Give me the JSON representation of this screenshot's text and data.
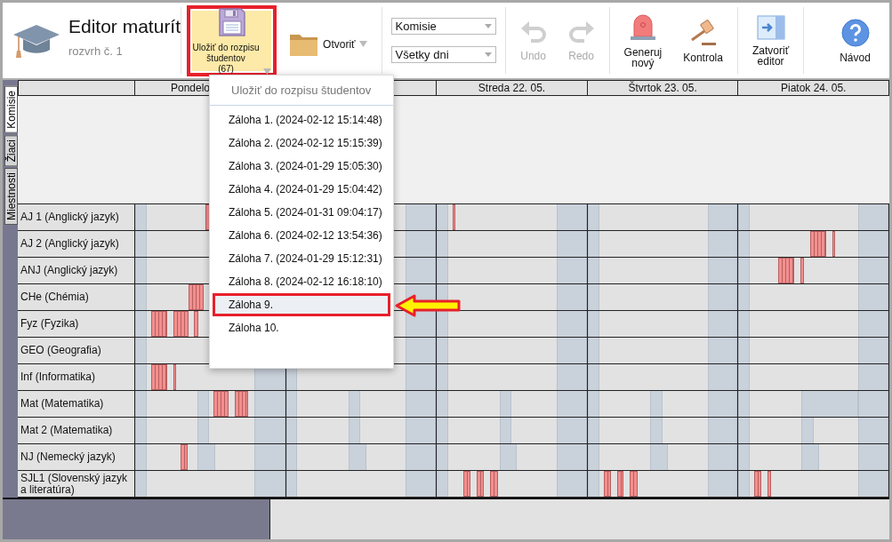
{
  "app": {
    "title": "Editor maturít",
    "subtitle": "rozvrh č. 1"
  },
  "toolbar_groups": [
    {
      "kind": "buttons",
      "items": [
        {
          "kind": "save",
          "label": "Uložiť do rozpisu\nštudentov\n(67)",
          "menu": true,
          "highlighted": true,
          "disabled": false
        },
        {
          "kind": "open",
          "label": "Otvoriť",
          "menu": true,
          "highlighted": false,
          "disabled": false
        }
      ]
    },
    {
      "kind": "selects",
      "items": [
        {
          "value": "Komisie"
        },
        {
          "value": "Všetky dni"
        }
      ]
    },
    {
      "kind": "buttons",
      "items": [
        {
          "kind": "undo",
          "label": "Undo",
          "menu": false,
          "highlighted": false,
          "disabled": true
        },
        {
          "kind": "redo",
          "label": "Redo",
          "menu": false,
          "highlighted": false,
          "disabled": true
        }
      ]
    },
    {
      "kind": "buttons",
      "items": [
        {
          "kind": "generate",
          "label": "Generuj\nnový",
          "menu": false,
          "highlighted": false,
          "disabled": false
        },
        {
          "kind": "check",
          "label": "Kontrola",
          "menu": false,
          "highlighted": false,
          "disabled": false
        }
      ]
    },
    {
      "kind": "buttons",
      "items": [
        {
          "kind": "close",
          "label": "Zatvoriť\neditor",
          "menu": false,
          "highlighted": false,
          "disabled": false
        }
      ]
    },
    {
      "kind": "buttons",
      "items": [
        {
          "kind": "help",
          "label": "Návod",
          "menu": false,
          "highlighted": false,
          "disabled": false
        }
      ]
    }
  ],
  "side_tabs": [
    {
      "label": "Komisie",
      "selected": true
    },
    {
      "label": "Žiaci",
      "selected": false
    },
    {
      "label": "Miestnosti",
      "selected": false
    }
  ],
  "days": [
    {
      "label": "Pondelo",
      "cut": true
    },
    {
      "covered": true
    },
    {
      "label": "Streda 22. 05.",
      "cut": false
    },
    {
      "label": "Štvrtok 23. 05.",
      "cut": false
    },
    {
      "label": "Piatok 24. 05.",
      "cut": false
    }
  ],
  "rows": [
    {
      "label": "AJ 1 (Anglický jazyk)"
    },
    {
      "label": "AJ 2 (Anglický jazyk)"
    },
    {
      "label": "ANJ (Anglický jazyk)"
    },
    {
      "label": "CHe (Chémia)"
    },
    {
      "label": "Fyz (Fyzika)"
    },
    {
      "label": "GEO (Geografia)"
    },
    {
      "label": "Inf (Informatika)"
    },
    {
      "label": "Mat (Matematika)"
    },
    {
      "label": "Mat 2 (Matematika)"
    },
    {
      "label": "NJ (Nemecký jazyk)"
    },
    {
      "label": "SJL1 (Slovenský jazyk a literatúra)"
    }
  ],
  "menu": {
    "title": "Uložiť do rozpisu študentov",
    "items": [
      {
        "label": "Záloha 1. (2024-02-12 15:14:48)",
        "selected": false
      },
      {
        "label": "Záloha 2. (2024-02-12 15:15:39)",
        "selected": false
      },
      {
        "label": "Záloha 3. (2024-01-29 15:05:30)",
        "selected": false
      },
      {
        "label": "Záloha 4. (2024-01-29 15:04:42)",
        "selected": false
      },
      {
        "label": "Záloha 5. (2024-01-31 09:04:17)",
        "selected": false
      },
      {
        "label": "Záloha 6. (2024-02-12 13:54:36)",
        "selected": false
      },
      {
        "label": "Záloha 7. (2024-01-29 15:12:31)",
        "selected": false
      },
      {
        "label": "Záloha 8. (2024-02-12 16:18:10)",
        "selected": false
      },
      {
        "label": "Záloha 9.",
        "selected": true
      },
      {
        "label": "Záloha 10.",
        "selected": false
      }
    ]
  }
}
